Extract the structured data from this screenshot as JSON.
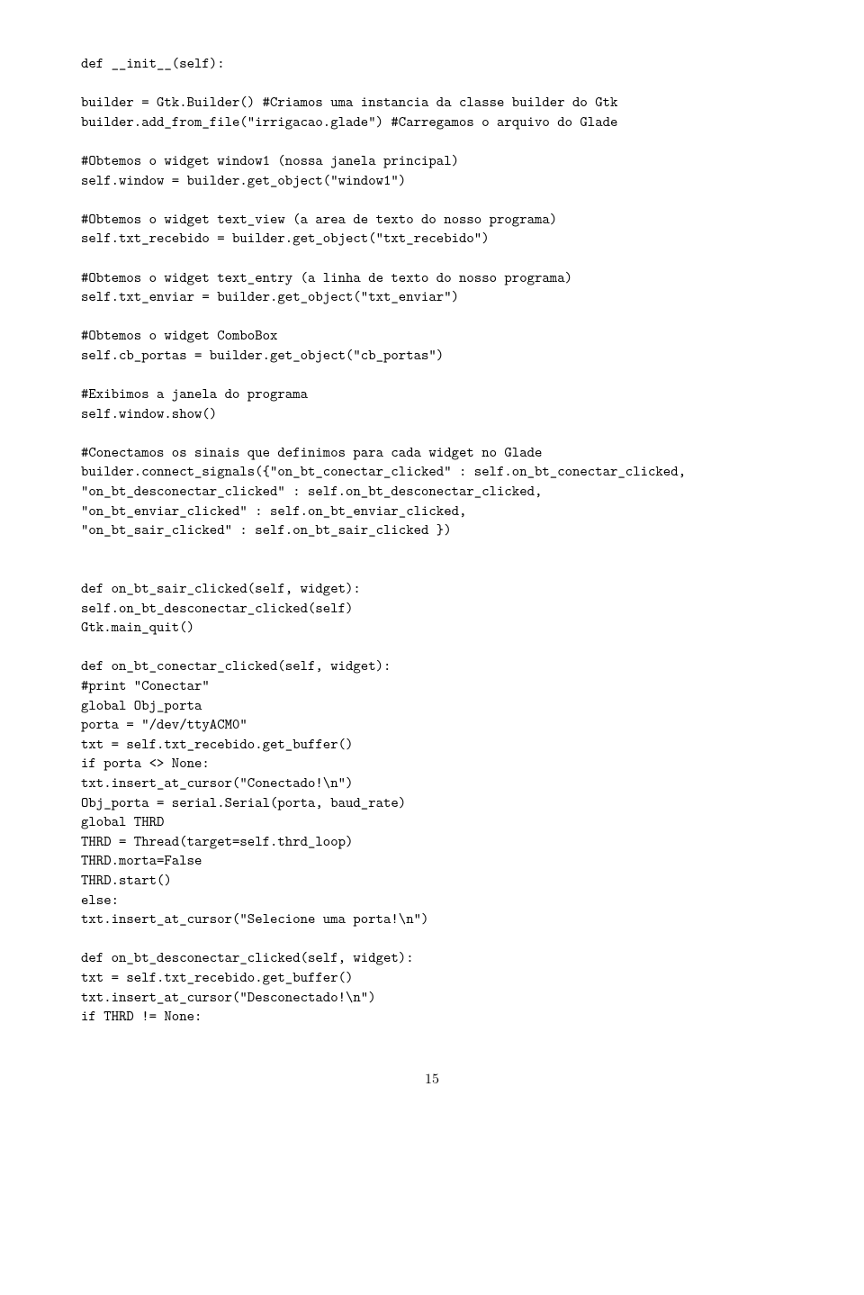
{
  "code": {
    "lines": [
      "def __init__(self):",
      "",
      "builder = Gtk.Builder() #Criamos uma instancia da classe builder do Gtk",
      "builder.add_from_file(\"irrigacao.glade\") #Carregamos o arquivo do Glade",
      "",
      "#Obtemos o widget window1 (nossa janela principal)",
      "self.window = builder.get_object(\"window1\")",
      "",
      "#Obtemos o widget text_view (a area de texto do nosso programa)",
      "self.txt_recebido = builder.get_object(\"txt_recebido\")",
      "",
      "#Obtemos o widget text_entry (a linha de texto do nosso programa)",
      "self.txt_enviar = builder.get_object(\"txt_enviar\")",
      "",
      "#Obtemos o widget ComboBox",
      "self.cb_portas = builder.get_object(\"cb_portas\")",
      "",
      "#Exibimos a janela do programa",
      "self.window.show()",
      "",
      "#Conectamos os sinais que definimos para cada widget no Glade",
      "builder.connect_signals({\"on_bt_conectar_clicked\" : self.on_bt_conectar_clicked,",
      "\"on_bt_desconectar_clicked\" : self.on_bt_desconectar_clicked,",
      "\"on_bt_enviar_clicked\" : self.on_bt_enviar_clicked,",
      "\"on_bt_sair_clicked\" : self.on_bt_sair_clicked })",
      "",
      "",
      "def on_bt_sair_clicked(self, widget):",
      "self.on_bt_desconectar_clicked(self)",
      "Gtk.main_quit()",
      "",
      "def on_bt_conectar_clicked(self, widget):",
      "#print \"Conectar\"",
      "global Obj_porta",
      "porta = \"/dev/ttyACM0\"",
      "txt = self.txt_recebido.get_buffer()",
      "if porta <> None:",
      "txt.insert_at_cursor(\"Conectado!\\n\")",
      "Obj_porta = serial.Serial(porta, baud_rate)",
      "global THRD",
      "THRD = Thread(target=self.thrd_loop)",
      "THRD.morta=False",
      "THRD.start()",
      "else:",
      "txt.insert_at_cursor(\"Selecione uma porta!\\n\")",
      "",
      "def on_bt_desconectar_clicked(self, widget):",
      "txt = self.txt_recebido.get_buffer()",
      "txt.insert_at_cursor(\"Desconectado!\\n\")",
      "if THRD != None:"
    ]
  },
  "page_number": "15"
}
